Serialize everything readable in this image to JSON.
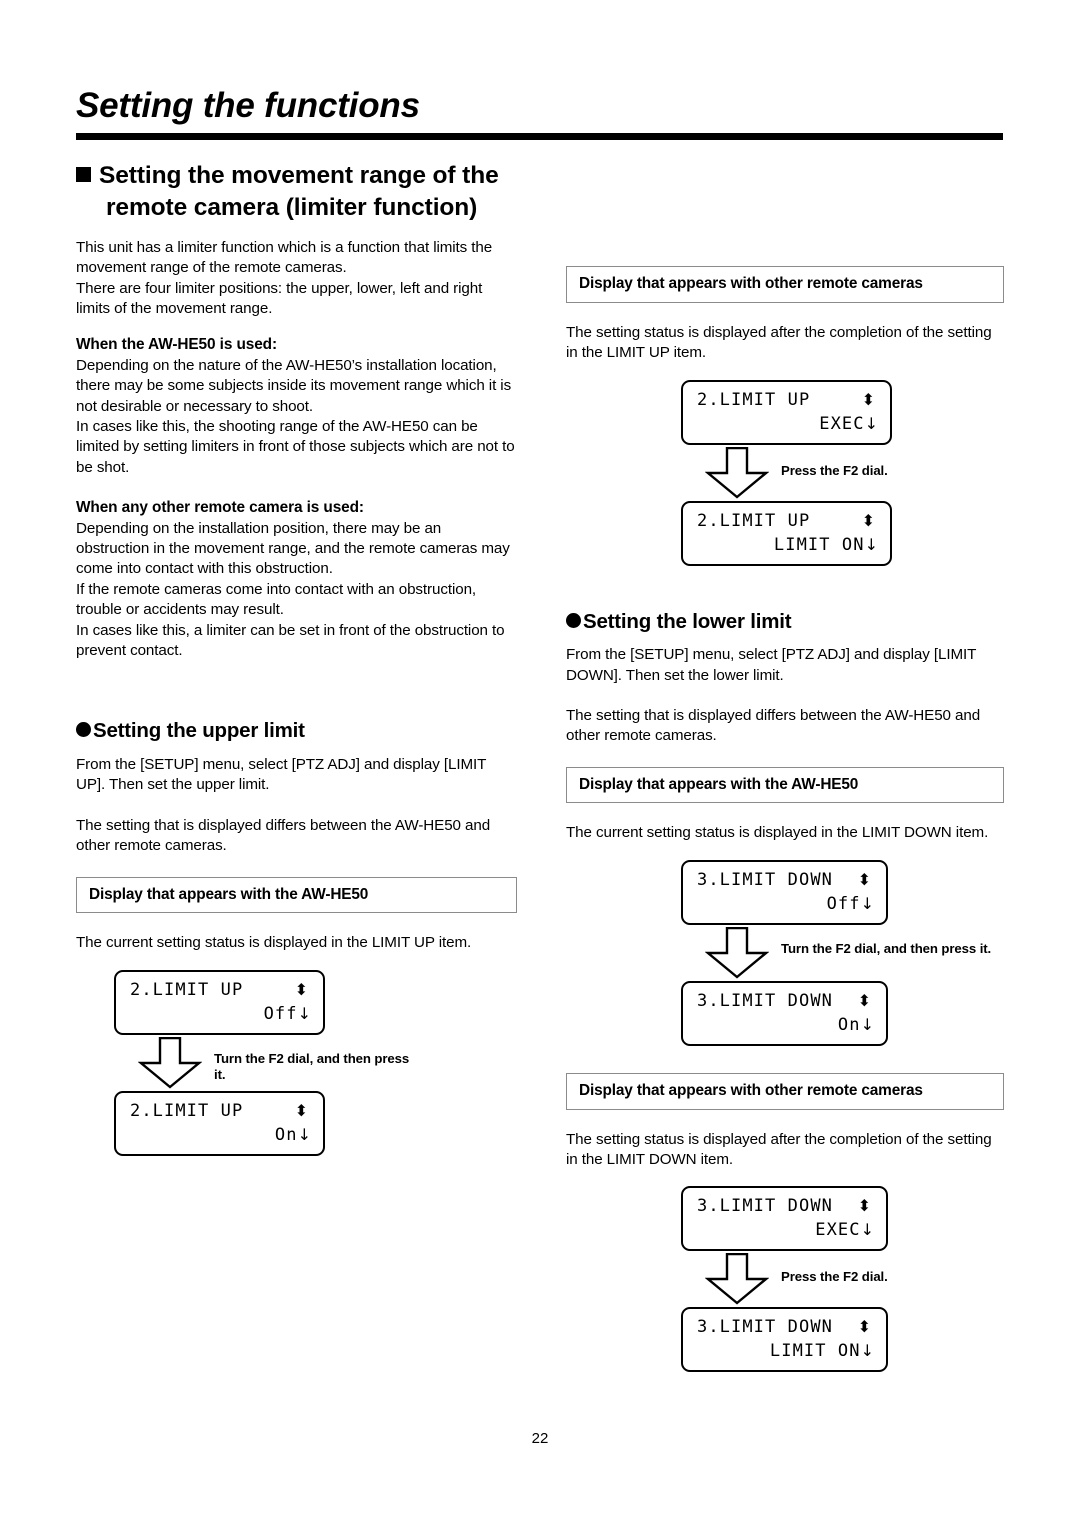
{
  "page": {
    "title": "Setting the functions",
    "number": "22"
  },
  "left": {
    "section_heading": "Setting the movement range of the remote camera (limiter function)",
    "intro": [
      "This unit has a limiter function which is a function that limits the movement range of the remote cameras.",
      "There are four limiter positions: the upper, lower, left and right limits of the movement range."
    ],
    "subhead_he50": "When the AW-HE50 is used:",
    "he50_body": [
      "Depending on the nature of the AW-HE50’s installation location, there may be some subjects inside its movement range which it is not desirable or necessary to shoot.",
      "In cases like this, the shooting range of the AW-HE50 can be limited by setting limiters in front of those subjects which are not to be shot."
    ],
    "subhead_other": "When any other remote camera is used:",
    "other_body": [
      "Depending on the installation position, there may be an obstruction in the movement range, and the remote cameras may come into contact with this obstruction.",
      "If the remote cameras come into contact with an obstruction, trouble or accidents may result.",
      "In cases like this, a limiter can be set in front of the obstruction to prevent contact."
    ],
    "upper_limit": {
      "heading": "Setting the upper limit",
      "para1": "From the [SETUP] menu, select [PTZ ADJ] and display [LIMIT UP]. Then set the upper limit.",
      "para2": "The setting that is displayed differs between the AW-HE50 and other remote cameras.",
      "caption_box": "Display that appears with the AW-HE50",
      "para3": "The current setting status is displayed in the LIMIT UP item.",
      "lcd_before": {
        "line1": "2.LIMIT UP",
        "updown_icon": "up-down-arrow-icon",
        "line2": "Off",
        "down_icon": "down-arrow-icon"
      },
      "flow_caption": "Turn the F2 dial, and then press it.",
      "lcd_after": {
        "line1": "2.LIMIT UP",
        "updown_icon": "up-down-arrow-icon",
        "line2": "On",
        "down_icon": "down-arrow-icon"
      }
    }
  },
  "right": {
    "upper_other": {
      "caption_box": "Display that appears with other remote cameras",
      "para1": "The setting status is displayed after the completion of the setting in the LIMIT UP item.",
      "lcd_before": {
        "line1": "2.LIMIT UP",
        "updown_icon": "up-down-arrow-icon",
        "line2": "EXEC",
        "down_icon": "down-arrow-icon"
      },
      "flow_caption": "Press the F2 dial.",
      "lcd_after": {
        "line1": "2.LIMIT UP",
        "updown_icon": "up-down-arrow-icon",
        "line2": "LIMIT ON",
        "down_icon": "down-arrow-icon"
      }
    },
    "lower_limit": {
      "heading": "Setting the lower limit",
      "para1": "From the [SETUP] menu, select [PTZ ADJ] and display [LIMIT DOWN]. Then set the lower limit.",
      "para2": "The setting that is displayed differs between the AW-HE50 and other remote cameras.",
      "caption_box_he50": "Display that appears with the AW-HE50",
      "para3": "The current setting status is displayed in the LIMIT DOWN item.",
      "lcd_before": {
        "line1": "3.LIMIT DOWN",
        "updown_icon": "up-down-arrow-icon",
        "line2": "Off",
        "down_icon": "down-arrow-icon"
      },
      "flow_caption": "Turn the F2 dial, and then press it.",
      "lcd_after": {
        "line1": "3.LIMIT DOWN",
        "updown_icon": "up-down-arrow-icon",
        "line2": "On",
        "down_icon": "down-arrow-icon"
      },
      "caption_box_other": "Display that appears with other remote cameras",
      "para4": "The setting status is displayed after the completion of the setting in the LIMIT DOWN item.",
      "lcd_before_other": {
        "line1": "3.LIMIT DOWN",
        "updown_icon": "up-down-arrow-icon",
        "line2": "EXEC",
        "down_icon": "down-arrow-icon"
      },
      "flow_caption_other": "Press the F2 dial.",
      "lcd_after_other": {
        "line1": "3.LIMIT DOWN",
        "updown_icon": "up-down-arrow-icon",
        "line2": "LIMIT ON",
        "down_icon": "down-arrow-icon"
      }
    }
  }
}
